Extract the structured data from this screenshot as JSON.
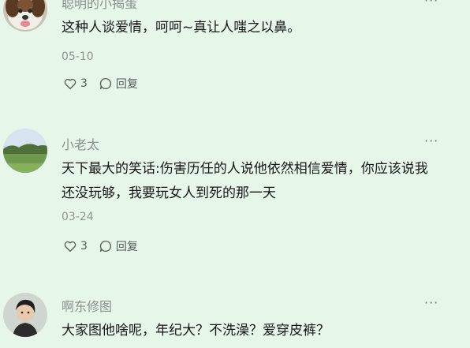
{
  "comments": [
    {
      "username": "聪明的小揭蛋",
      "more": "···",
      "text": "这种人谈爱情，呵呵~真让人嗤之以鼻。",
      "date": "05-10",
      "likes": "3",
      "reply_label": "回复",
      "avatar_icon": "dog-avatar"
    },
    {
      "username": "小老太",
      "more": "···",
      "text": "天下最大的笑话:伤害历任的人说他依然相信爱情，你应该说我还没玩够，我要玩女人到死的那一天",
      "date": "03-24",
      "likes": "3",
      "reply_label": "回复",
      "avatar_icon": "landscape-avatar"
    },
    {
      "username": "啊东修图",
      "more": "···",
      "text": "大家图他啥呢，年纪大？不洗澡？爱穿皮裤？",
      "avatar_icon": "person-avatar"
    }
  ],
  "colors": {
    "background": "#e6f7e9",
    "text": "#161616",
    "meta": "#8f9491"
  }
}
